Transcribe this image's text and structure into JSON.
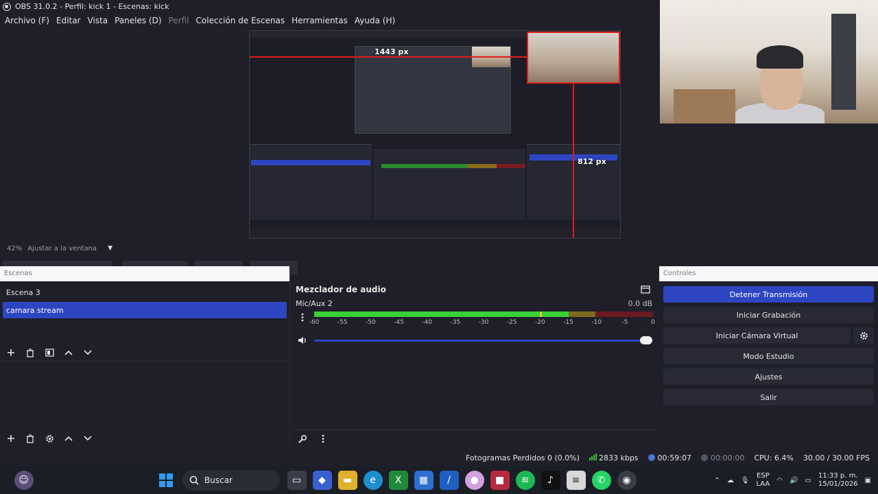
{
  "window": {
    "title": "OBS 31.0.2 - Perfil: kick 1 - Escenas: kick"
  },
  "menu": [
    "Archivo (F)",
    "Editar",
    "Vista",
    "Paneles (D)",
    "Perfil",
    "Colección de Escenas",
    "Herramientas",
    "Ayuda (H)"
  ],
  "preview": {
    "width_label": "1443 px",
    "height_label": "812 px",
    "zoom": "42%",
    "zoom_mode": "Ajustar a la ventana"
  },
  "scenes": {
    "title": "Escenas",
    "items": [
      "Escena 3",
      "camara stream"
    ],
    "selected": "camara stream"
  },
  "mixer": {
    "title": "Mezclador de audio",
    "track": {
      "name": "Mic/Aux 2",
      "db": "0.0 dB",
      "level": 0.75,
      "peak": 0.665,
      "volume": 1.0
    },
    "scale": [
      "-60",
      "-55",
      "-50",
      "-45",
      "-40",
      "-35",
      "-30",
      "-25",
      "-20",
      "-15",
      "-10",
      "-5",
      "0"
    ]
  },
  "controls": {
    "title": "Controles",
    "stop_stream": "Detener Transmisión",
    "start_recording": "Iniciar Grabación",
    "start_virtual_cam": "Iniciar Cámara Virtual",
    "studio_mode": "Modo Estudio",
    "settings": "Ajustes",
    "exit": "Salir"
  },
  "status": {
    "dropped_frames": "Fotogramas Perdidos 0 (0.0%)",
    "bitrate": "2833 kbps",
    "stream_time": "00:59:07",
    "record_time": "00:00:00",
    "cpu": "CPU: 6.4%",
    "fps": "30.00 / 30.00 FPS"
  },
  "taskbar": {
    "search_label": "Buscar",
    "lang_1": "ESP",
    "lang_2": "LAA",
    "time": "11:33 p. m.",
    "date": "15/01/2026"
  },
  "colors": {
    "accent": "#2e45c2",
    "selection_red": "#e01c1c",
    "meter_green": "#3ad13a"
  }
}
